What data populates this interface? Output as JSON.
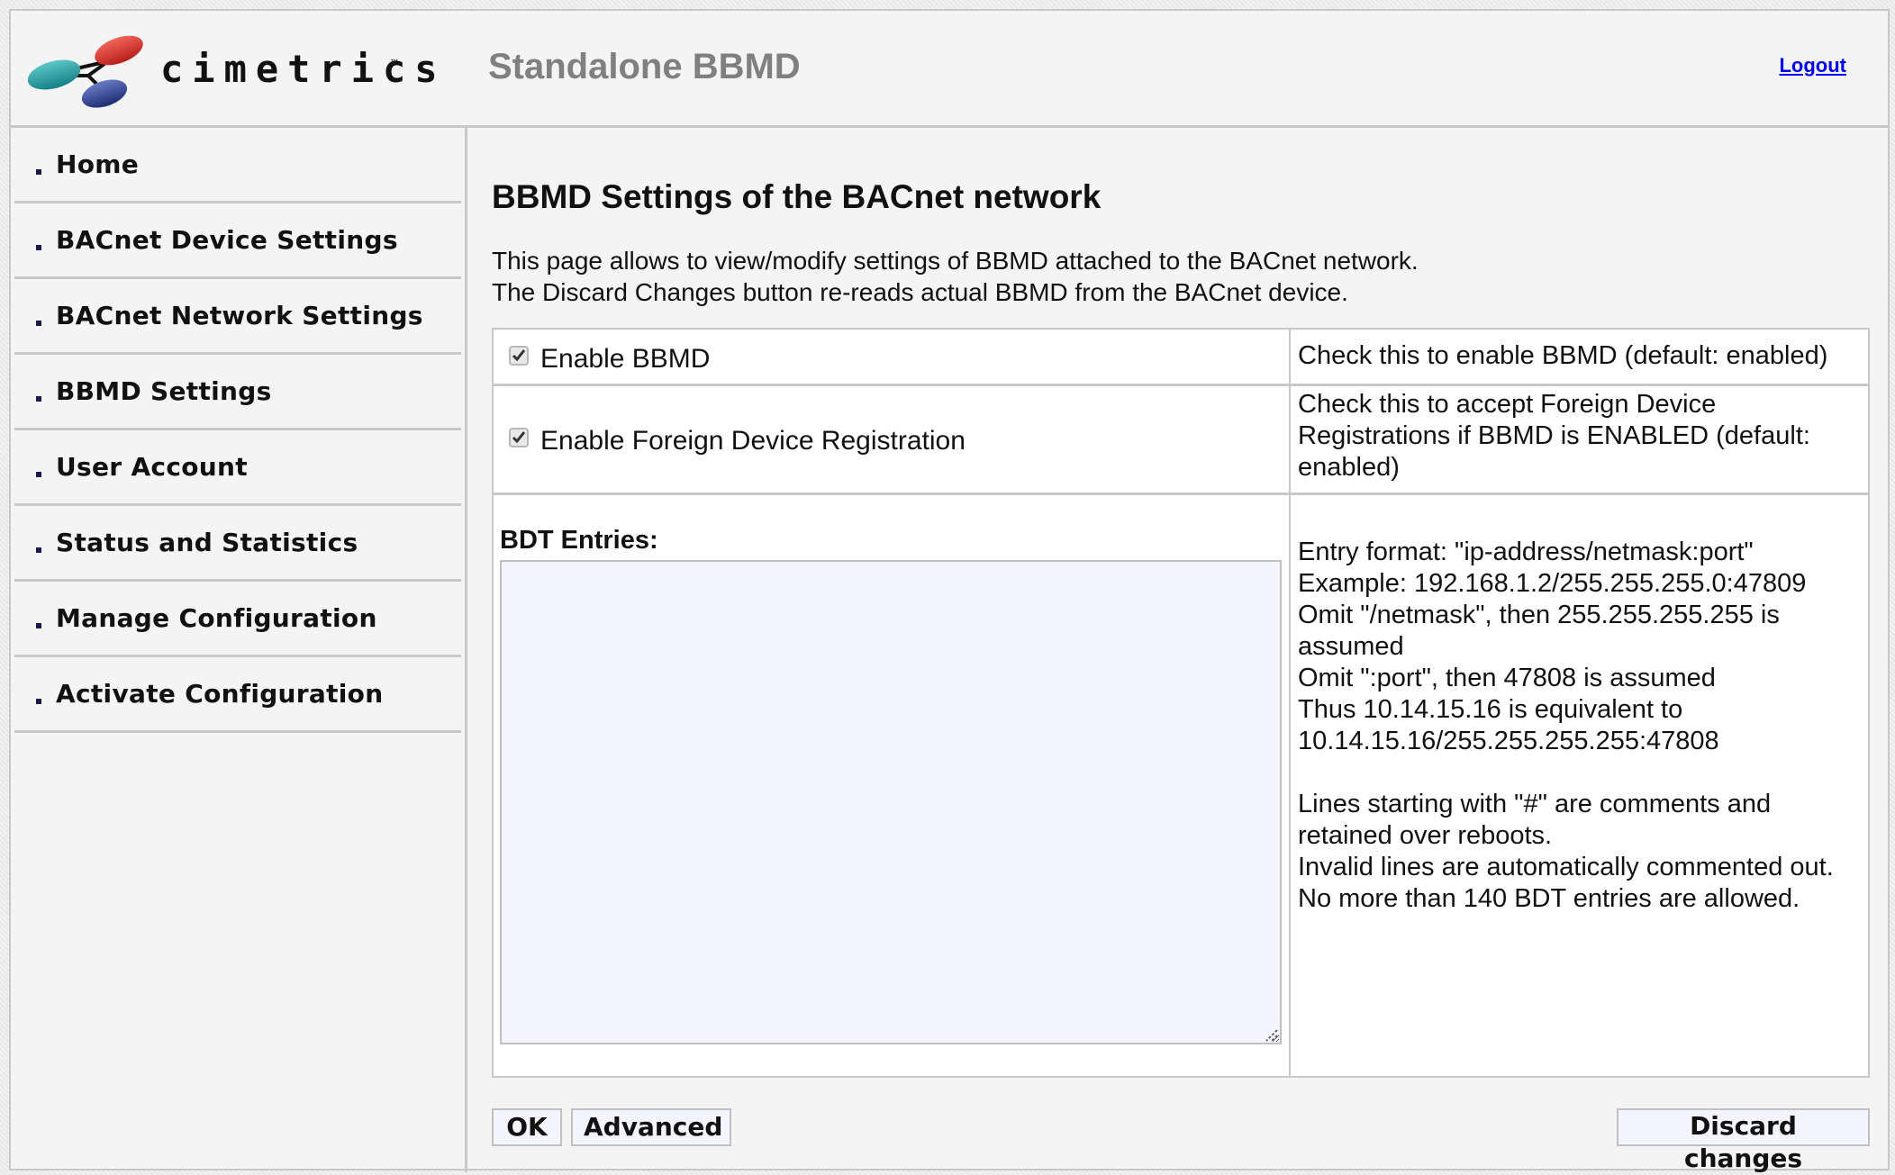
{
  "header": {
    "brand": "cimetrics",
    "brand_mark": "™",
    "title": "Standalone BBMD",
    "logout_label": "Logout",
    "logo_colors": {
      "red": "#d9342b",
      "teal": "#1fa3a8",
      "blue": "#2b3f8f"
    }
  },
  "sidebar": {
    "items": [
      {
        "label": "Home"
      },
      {
        "label": "BACnet Device Settings"
      },
      {
        "label": "BACnet Network Settings"
      },
      {
        "label": "BBMD Settings"
      },
      {
        "label": "User Account"
      },
      {
        "label": "Status and Statistics"
      },
      {
        "label": "Manage Configuration"
      },
      {
        "label": "Activate Configuration"
      }
    ]
  },
  "main": {
    "heading": "BBMD Settings of the BACnet network",
    "description": [
      "This page allows to view/modify settings of BBMD attached to the BACnet network.",
      "The Discard Changes button re-reads actual BBMD from the BACnet device."
    ],
    "settings": {
      "enable_bbmd": {
        "label": "Enable BBMD",
        "checked": true,
        "help": "Check this to enable BBMD (default: enabled)"
      },
      "enable_fdr": {
        "label": "Enable Foreign Device Registration",
        "checked": true,
        "help": [
          "Check this to accept Foreign Device",
          "Registrations if BBMD is ENABLED (default:",
          "enabled)"
        ]
      },
      "bdt": {
        "label": "BDT Entries:",
        "value": "",
        "help": [
          "Entry format: \"ip-address/netmask:port\"",
          "Example: 192.168.1.2/255.255.255.0:47809",
          "Omit \"/netmask\", then 255.255.255.255 is",
          "assumed",
          "Omit \":port\", then 47808 is assumed",
          "Thus 10.14.15.16 is equivalent to",
          "10.14.15.16/255.255.255.255:47808",
          "",
          "Lines starting with \"#\" are comments and",
          "retained over reboots.",
          "Invalid lines are automatically commented out.",
          "No more than 140 BDT entries are allowed."
        ]
      }
    },
    "buttons": {
      "ok": "OK",
      "advanced": "Advanced",
      "discard": "Discard changes"
    }
  }
}
